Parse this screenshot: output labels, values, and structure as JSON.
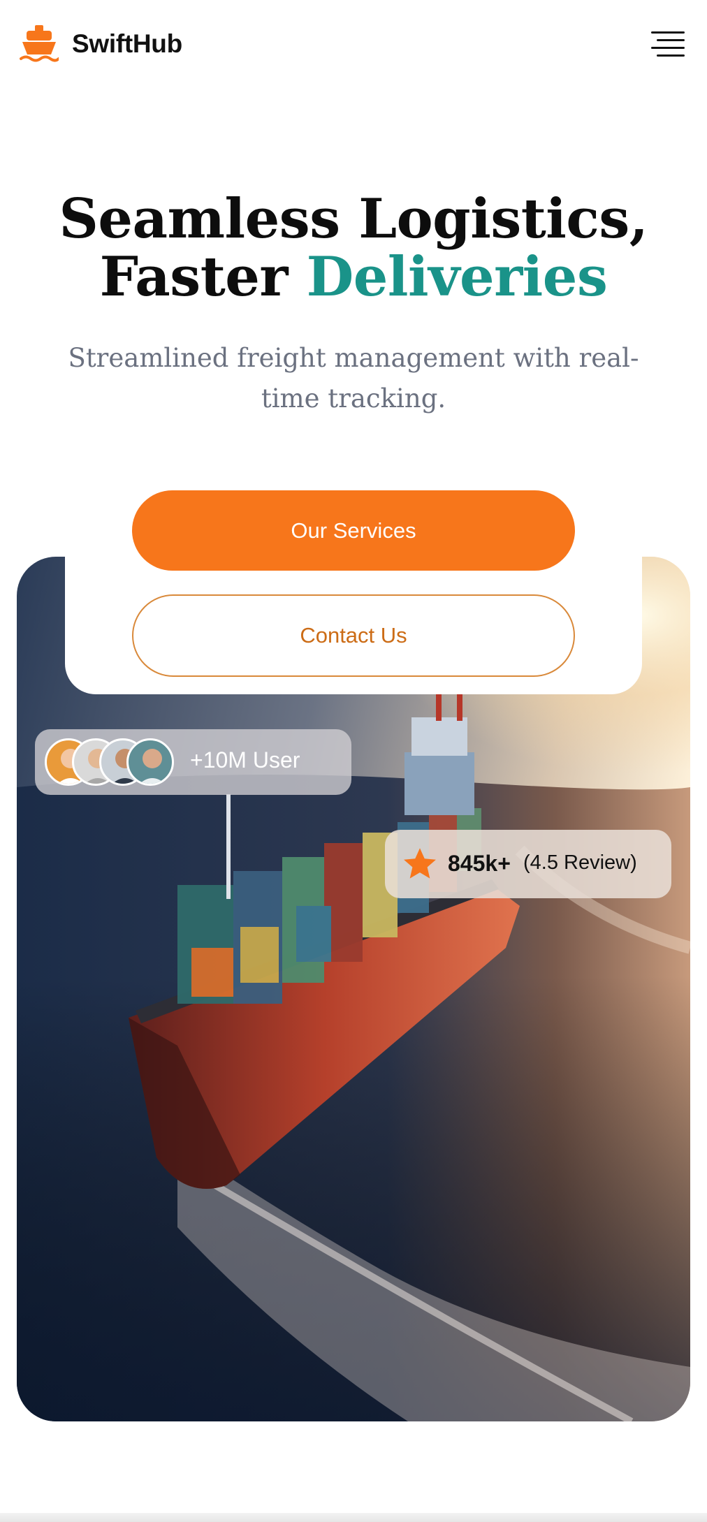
{
  "header": {
    "brand": "SwiftHub",
    "logo_icon": "ship-icon",
    "menu_icon": "hamburger-menu-icon"
  },
  "hero": {
    "title_line1": "Seamless Logistics,",
    "title_line2_plain": "Faster ",
    "title_line2_accent": "Deliveries",
    "subtitle": "Streamlined freight management with real-time tracking."
  },
  "actions": {
    "primary_label": "Our Services",
    "secondary_label": "Contact Us"
  },
  "stats": {
    "users_label": "+10M User",
    "reviews_count": "845k+",
    "reviews_rating": "(4.5 Review)",
    "rating_icon": "star-icon"
  },
  "colors": {
    "accent_orange": "#f7761b",
    "accent_teal": "#1a9389",
    "subtitle_gray": "#6b7180"
  }
}
